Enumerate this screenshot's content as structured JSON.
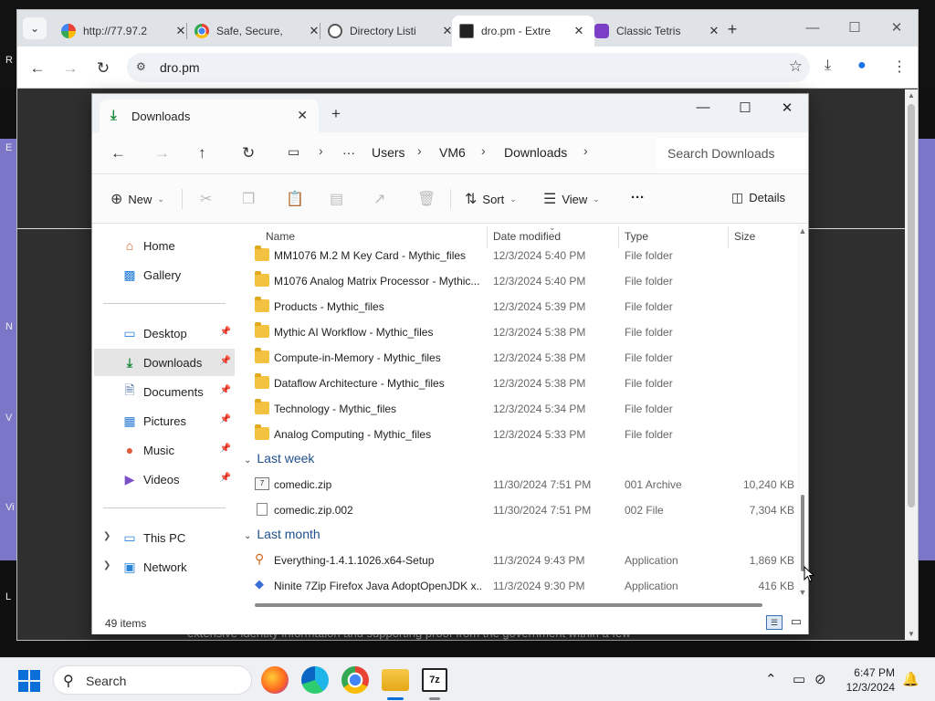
{
  "desktop": {
    "edge_letters": [
      "R",
      "E",
      "N",
      "V",
      "Vi",
      "L"
    ]
  },
  "browser": {
    "tabs": [
      {
        "title": "http://77.97.2",
        "favicon": "google-icon",
        "active": false
      },
      {
        "title": "Safe, Secure,",
        "favicon": "chrome-icon",
        "active": false
      },
      {
        "title": "Directory Listi",
        "favicon": "globe-icon",
        "active": false
      },
      {
        "title": "dro.pm - Extre",
        "favicon": "dropm-icon",
        "active": true
      },
      {
        "title": "Classic Tetris",
        "favicon": "tetris-icon",
        "active": false
      }
    ],
    "url": "dro.pm",
    "page_caption": "extensive identity information and supporting proof from the government within a few"
  },
  "explorer": {
    "tab_title": "Downloads",
    "breadcrumb": [
      "Users",
      "VM6",
      "Downloads"
    ],
    "search_placeholder": "Search Downloads",
    "toolbar": {
      "new_label": "New",
      "sort_label": "Sort",
      "view_label": "View",
      "more_label": "···",
      "details_label": "Details"
    },
    "sidebar": {
      "top": [
        {
          "label": "Home",
          "icon": "home-icon"
        },
        {
          "label": "Gallery",
          "icon": "gallery-icon"
        }
      ],
      "pinned": [
        {
          "label": "Desktop",
          "icon": "desktop-icon"
        },
        {
          "label": "Downloads",
          "icon": "download-icon",
          "selected": true
        },
        {
          "label": "Documents",
          "icon": "documents-icon"
        },
        {
          "label": "Pictures",
          "icon": "pictures-icon"
        },
        {
          "label": "Music",
          "icon": "music-icon"
        },
        {
          "label": "Videos",
          "icon": "videos-icon"
        }
      ],
      "locations": [
        {
          "label": "This PC",
          "icon": "pc-icon"
        },
        {
          "label": "Network",
          "icon": "network-icon"
        }
      ]
    },
    "columns": {
      "name": "Name",
      "date": "Date modified",
      "type": "Type",
      "size": "Size"
    },
    "rows_earlier": [
      {
        "name": "MM1076 M.2 M Key Card - Mythic_files",
        "date": "12/3/2024 5:40 PM",
        "type": "File folder",
        "size": ""
      },
      {
        "name": "M1076 Analog Matrix Processor - Mythic...",
        "date": "12/3/2024 5:40 PM",
        "type": "File folder",
        "size": ""
      },
      {
        "name": "Products - Mythic_files",
        "date": "12/3/2024 5:39 PM",
        "type": "File folder",
        "size": ""
      },
      {
        "name": "Mythic AI Workflow - Mythic_files",
        "date": "12/3/2024 5:38 PM",
        "type": "File folder",
        "size": ""
      },
      {
        "name": "Compute-in-Memory - Mythic_files",
        "date": "12/3/2024 5:38 PM",
        "type": "File folder",
        "size": ""
      },
      {
        "name": "Dataflow Architecture - Mythic_files",
        "date": "12/3/2024 5:38 PM",
        "type": "File folder",
        "size": ""
      },
      {
        "name": "Technology - Mythic_files",
        "date": "12/3/2024 5:34 PM",
        "type": "File folder",
        "size": ""
      },
      {
        "name": "Analog Computing - Mythic_files",
        "date": "12/3/2024 5:33 PM",
        "type": "File folder",
        "size": ""
      }
    ],
    "group_last_week": "Last week",
    "rows_last_week": [
      {
        "name": "comedic.zip",
        "date": "11/30/2024 7:51 PM",
        "type": "001 Archive",
        "size": "10,240 KB"
      },
      {
        "name": "comedic.zip.002",
        "date": "11/30/2024 7:51 PM",
        "type": "002 File",
        "size": "7,304 KB"
      }
    ],
    "group_last_month": "Last month",
    "rows_last_month": [
      {
        "name": "Everything-1.4.1.1026.x64-Setup",
        "date": "11/3/2024 9:43 PM",
        "type": "Application",
        "size": "1,869 KB"
      },
      {
        "name": "Ninite 7Zip Firefox Java AdoptOpenJDK x...",
        "date": "11/3/2024 9:30 PM",
        "type": "Application",
        "size": "416 KB"
      }
    ],
    "status_count": "49 items"
  },
  "taskbar": {
    "search_label": "Search",
    "time": "6:47 PM",
    "date": "12/3/2024"
  },
  "colors": {
    "accent": "#0a6fd8",
    "folder": "#f3c241",
    "desktop_purple": "#7b76c8"
  }
}
